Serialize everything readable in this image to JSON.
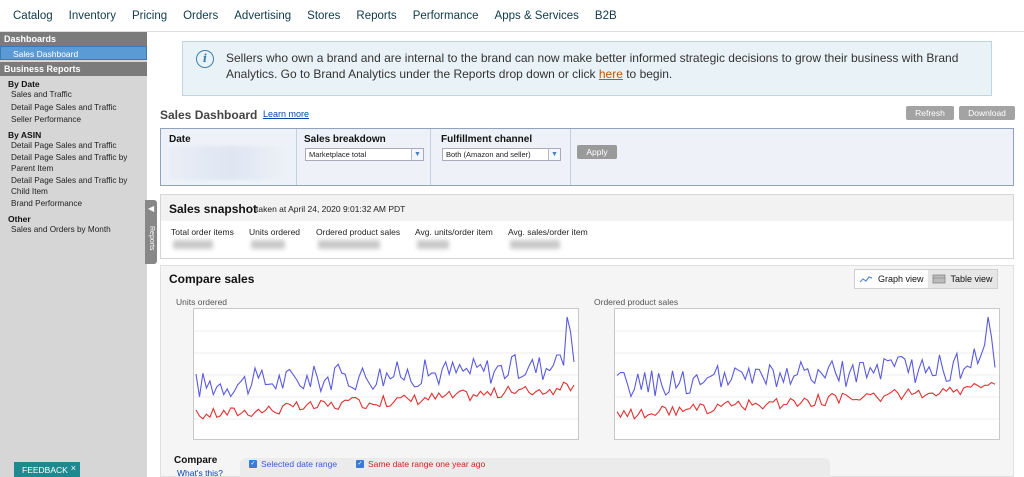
{
  "topnav": {
    "items": [
      "Catalog",
      "Inventory",
      "Pricing",
      "Orders",
      "Advertising",
      "Stores",
      "Reports",
      "Performance",
      "Apps & Services",
      "B2B"
    ]
  },
  "sidebar": {
    "dashboards_header": "Dashboards",
    "active_item": "Sales Dashboard",
    "reports_header": "Business Reports",
    "groups": [
      {
        "title": "By Date",
        "items": [
          "Sales and Traffic",
          "Detail Page Sales and Traffic",
          "Seller Performance"
        ]
      },
      {
        "title": "By ASIN",
        "items": [
          "Detail Page Sales and Traffic",
          "Detail Page Sales and Traffic by Parent Item",
          "Detail Page Sales and Traffic by Child Item",
          "Brand Performance"
        ]
      },
      {
        "title": "Other",
        "items": [
          "Sales and Orders by Month"
        ]
      }
    ],
    "handle_label": "Reports",
    "feedback_label": "FEEDBACK",
    "feedback_close": "×"
  },
  "banner": {
    "text_before": "Sellers who own a brand and are internal to the brand can now make better informed strategic decisions to grow their business with Brand Analytics. Go to Brand Analytics under the Reports drop down or click ",
    "link": "here",
    "text_after": " to begin."
  },
  "dashboard": {
    "title": "Sales Dashboard",
    "learn_more": "Learn more",
    "refresh": "Refresh",
    "download": "Download"
  },
  "filters": {
    "date_label": "Date",
    "breakdown_label": "Sales breakdown",
    "breakdown_value": "Marketplace total",
    "fulfillment_label": "Fulfillment channel",
    "fulfillment_value": "Both (Amazon and seller)",
    "apply": "Apply"
  },
  "snapshot": {
    "title": "Sales snapshot",
    "taken": "taken at April 24, 2020 9:01:32 AM PDT",
    "metrics": [
      "Total order items",
      "Units ordered",
      "Ordered product sales",
      "Avg. units/order item",
      "Avg. sales/order item"
    ]
  },
  "compare": {
    "title": "Compare sales",
    "graph_view": "Graph view",
    "table_view": "Table view",
    "chart1_label": "Units ordered",
    "chart2_label": "Ordered product sales",
    "legend_title": "Compare",
    "whats_this": "What's this?",
    "legend_selected": "Selected date range",
    "legend_lastyear": "Same date range one year ago",
    "colors": {
      "selected": "#5a5ae0",
      "lastyear": "#e03030"
    }
  }
}
